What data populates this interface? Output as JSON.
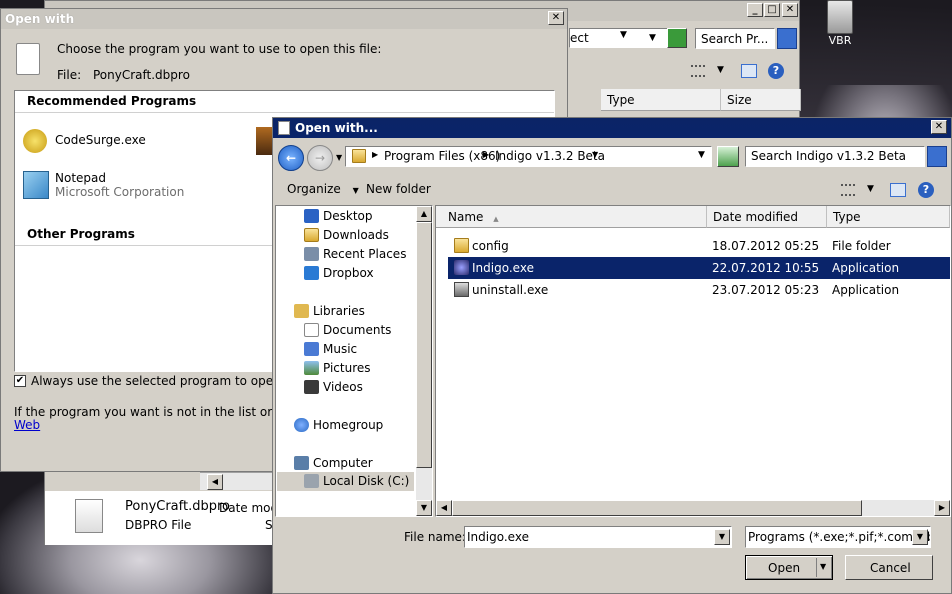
{
  "colors": {
    "title_active": "#0a246a",
    "selection": "#0a246a",
    "window_bg": "#d4d0c8",
    "link": "#0000cc"
  },
  "desktop": {
    "icon_label": "VBR"
  },
  "background_window": {
    "search_placeholder": "Search Pr...",
    "dropdown_fragment": "ect",
    "columns": [
      "Type",
      "Size"
    ],
    "details": {
      "file_name": "PonyCraft.dbpro",
      "file_type": "DBPRO File",
      "date_fragment": "Date modif",
      "size_fragment": "S"
    },
    "buttons": {
      "minimize": "_",
      "maximize": "□",
      "close": "✕"
    }
  },
  "open_with_small": {
    "title": "Open with",
    "prompt": "Choose the program you want to use to open this file:",
    "file_label": "File:",
    "file_name": "PonyCraft.dbpro",
    "recommended_header": "Recommended Programs",
    "recommended": [
      {
        "name": "CodeSurge.exe",
        "publisher": ""
      },
      {
        "name": "Notepad",
        "publisher": "Microsoft Corporation"
      }
    ],
    "other_header": "Other Programs",
    "always_use": "Always use the selected program to open this kind",
    "hint": "If the program you want is not in the list or on your co",
    "web_link": "Web",
    "close": "✕"
  },
  "open_dialog": {
    "title": "Open with...",
    "close": "✕",
    "breadcrumb": [
      "Program Files (x86)",
      "Indigo v1.3.2 Beta"
    ],
    "search_placeholder": "Search Indigo v1.3.2 Beta",
    "toolbar": {
      "organize": "Organize",
      "new_folder": "New folder"
    },
    "nav": {
      "favorites": [
        "Desktop",
        "Downloads",
        "Recent Places",
        "Dropbox"
      ],
      "libraries_label": "Libraries",
      "libraries": [
        "Documents",
        "Music",
        "Pictures",
        "Videos"
      ],
      "homegroup": "Homegroup",
      "computer": "Computer",
      "drives": [
        "Local Disk (C:)"
      ]
    },
    "columns": {
      "name": "Name",
      "date": "Date modified",
      "type": "Type"
    },
    "files": [
      {
        "name": "config",
        "date": "18.07.2012 05:25",
        "type": "File folder",
        "icon": "folder-icon"
      },
      {
        "name": "Indigo.exe",
        "date": "22.07.2012 10:55",
        "type": "Application",
        "icon": "app-icon"
      },
      {
        "name": "uninstall.exe",
        "date": "23.07.2012 05:23",
        "type": "Application",
        "icon": "installer-icon"
      }
    ],
    "file_name_label": "File name:",
    "file_name_value": "Indigo.exe",
    "filter": "Programs (*.exe;*.pif;*.com;*.ba",
    "open_button": "Open",
    "cancel_button": "Cancel"
  }
}
